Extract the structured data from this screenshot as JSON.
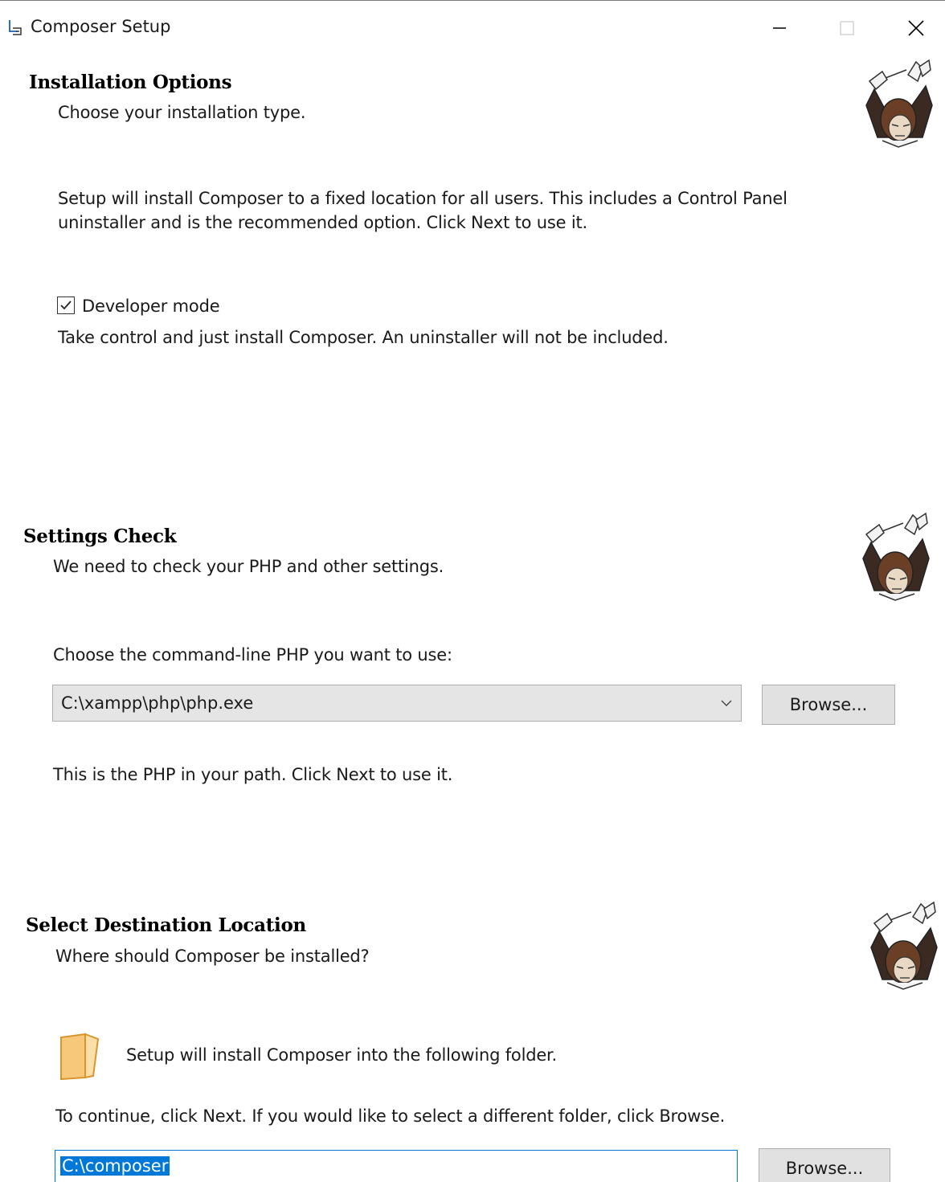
{
  "window": {
    "title": "Composer Setup",
    "icon": "composer-setup-icon",
    "controls": {
      "minimize": "minimize-icon",
      "maximize": "maximize-icon",
      "close": "close-icon"
    }
  },
  "installation_options": {
    "heading": "Installation Options",
    "subtitle": "Choose your installation type.",
    "description_line1": "Setup will install Composer to a fixed location for all users. This includes a Control Panel",
    "description_line2": "uninstaller and is the recommended option. Click Next to use it.",
    "developer_mode": {
      "label": "Developer mode",
      "checked": true
    },
    "developer_note": "Take control and just install Composer. An uninstaller will not be included."
  },
  "settings_check": {
    "heading": "Settings Check",
    "subtitle": "We need to check your PHP and other settings.",
    "prompt": "Choose the command-line PHP you want to use:",
    "php_path": "C:\\xampp\\php\\php.exe",
    "browse_label": "Browse...",
    "note": "This is the PHP in your path. Click Next to use it."
  },
  "destination": {
    "heading": "Select Destination Location",
    "subtitle": "Where should Composer be installed?",
    "folder_note": "Setup will install Composer into the following folder.",
    "instructions": "To continue, click Next. If you would like to select a different folder, click Browse.",
    "path": "C:\\composer",
    "browse_label": "Browse..."
  },
  "colors": {
    "accent": "#0078d7",
    "folder": "#f5c26b"
  }
}
